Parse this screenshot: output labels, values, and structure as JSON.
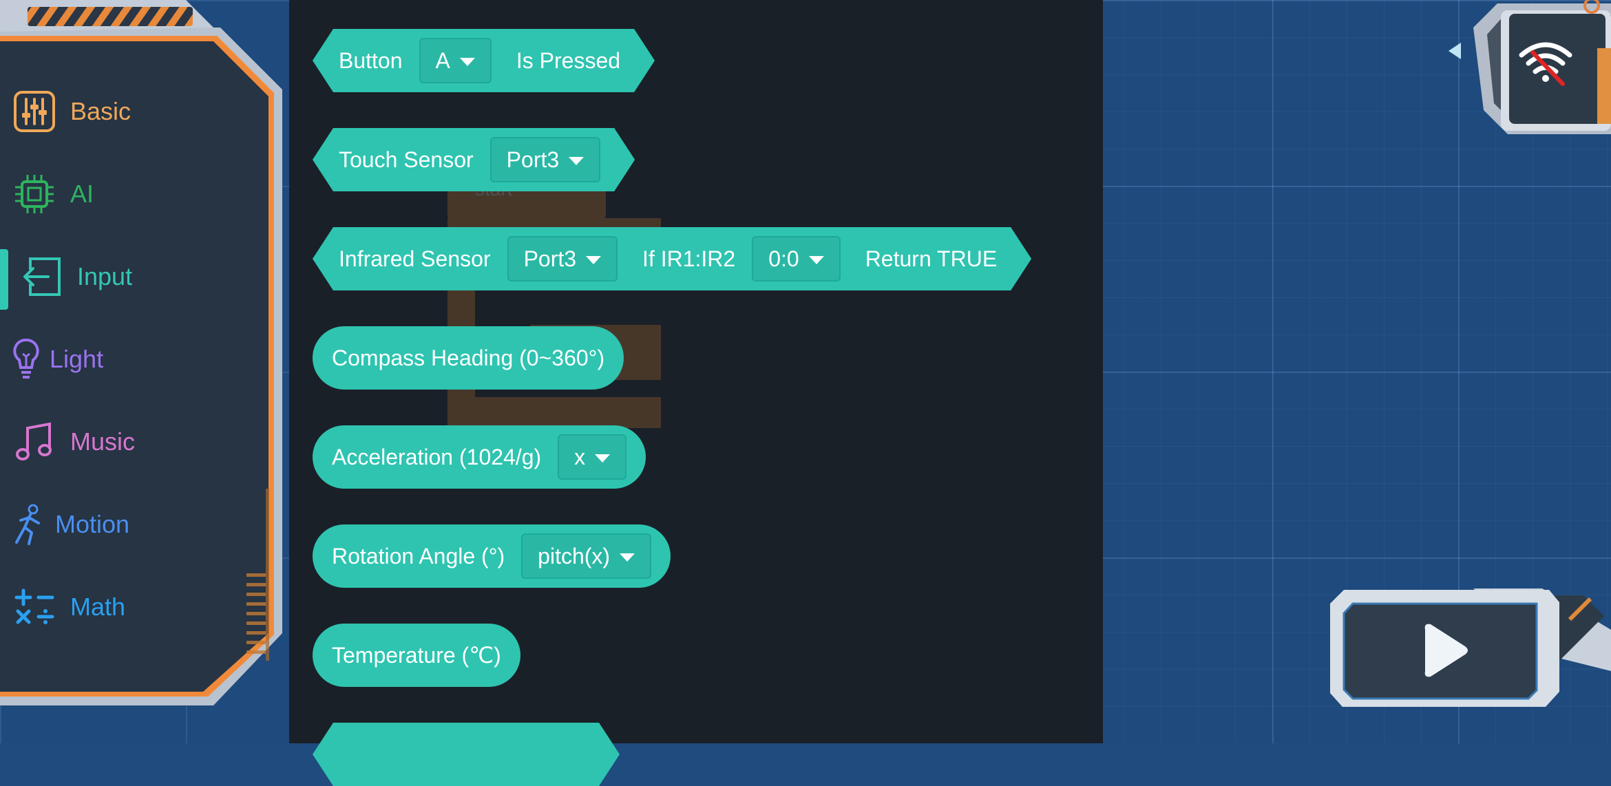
{
  "categories": [
    {
      "label": "Basic",
      "icon": "sliders-icon",
      "color": "#f0a858"
    },
    {
      "label": "AI",
      "icon": "chip-icon",
      "color": "#2db45e"
    },
    {
      "label": "Input",
      "icon": "input-icon",
      "color": "#34c6b4",
      "selected": true
    },
    {
      "label": "Light",
      "icon": "lightbulb-icon",
      "color": "#9b73f0"
    },
    {
      "label": "Music",
      "icon": "music-note-icon",
      "color": "#d876cf"
    },
    {
      "label": "Motion",
      "icon": "runner-icon",
      "color": "#4a8ff0"
    },
    {
      "label": "Math",
      "icon": "math-ops-icon",
      "color": "#2aa0f0"
    }
  ],
  "blocks": {
    "button": {
      "label": "Button",
      "dropdown": "A",
      "suffix": "Is Pressed"
    },
    "touch_sensor": {
      "label": "Touch Sensor",
      "dropdown": "Port3"
    },
    "infrared_sensor": {
      "label": "Infrared Sensor",
      "dropdown": "Port3",
      "mid": "If IR1:IR2",
      "dropdown2": "0:0",
      "suffix": "Return TRUE"
    },
    "compass": {
      "label": "Compass Heading (0~360°)"
    },
    "acceleration": {
      "label": "Acceleration (1024/g)",
      "dropdown": "x"
    },
    "rotation": {
      "label": "Rotation Angle (°)",
      "dropdown": "pitch(x)"
    },
    "temperature": {
      "label": "Temperature (℃)"
    }
  },
  "workspace": {
    "ghost_block_label": "start"
  },
  "colors": {
    "block": "#2ec4b0",
    "palette_bg": "#1a2028",
    "workspace_bg": "#1e4a7d",
    "accent_orange": "#f08a3a",
    "wifi_off": "#e02424"
  },
  "status_icons": [
    "wifi-off-icon",
    "play-icon",
    "collapse-arrow-icon"
  ]
}
